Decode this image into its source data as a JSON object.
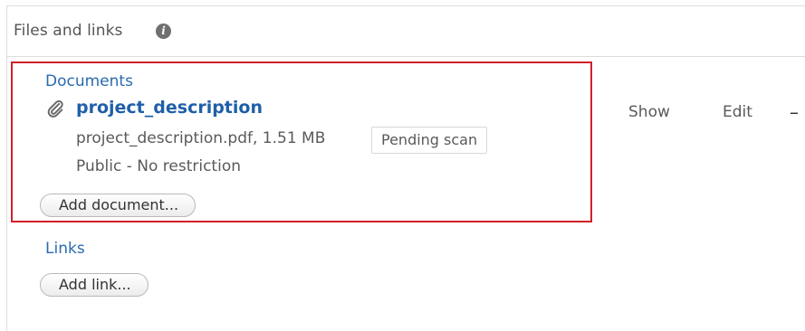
{
  "panel": {
    "title": "Files and links",
    "info_icon": "info-icon"
  },
  "documents": {
    "section_label": "Documents",
    "items": [
      {
        "name": "project_description",
        "icon": "paperclip-icon",
        "file_info": "project_description.pdf, 1.51 MB",
        "scan_status": "Pending scan",
        "visibility": "Public - No restriction",
        "actions": {
          "show": "Show",
          "edit": "Edit",
          "remove": "–"
        }
      }
    ],
    "add_button": "Add document..."
  },
  "links": {
    "section_label": "Links",
    "add_button": "Add link..."
  },
  "colors": {
    "accent_link": "#1f5fa8",
    "section_label": "#2a6bb0",
    "highlight_border": "#d0202a"
  }
}
